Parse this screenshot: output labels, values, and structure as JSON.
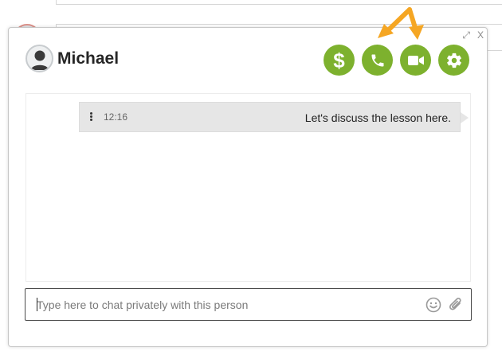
{
  "window": {
    "expand_icon": "expand-icon",
    "expand_glyph": "⤢",
    "close_label": "X"
  },
  "contact": {
    "name": "Michael",
    "avatar_icon": "user-avatar-icon"
  },
  "actions": {
    "payment_icon": "dollar-icon",
    "payment_glyph": "$",
    "call_icon": "phone-icon",
    "video_icon": "video-camera-icon",
    "settings_icon": "gear-icon",
    "accent_color": "#7db12e"
  },
  "annotations": {
    "arrow_color": "#f5a623"
  },
  "messages": [
    {
      "time": "12:16",
      "text": "Let's discuss the lesson here."
    }
  ],
  "composer": {
    "placeholder": "Type here to chat privately with this person",
    "value": "",
    "emoji_icon": "smiley-icon",
    "attach_icon": "paperclip-icon"
  }
}
